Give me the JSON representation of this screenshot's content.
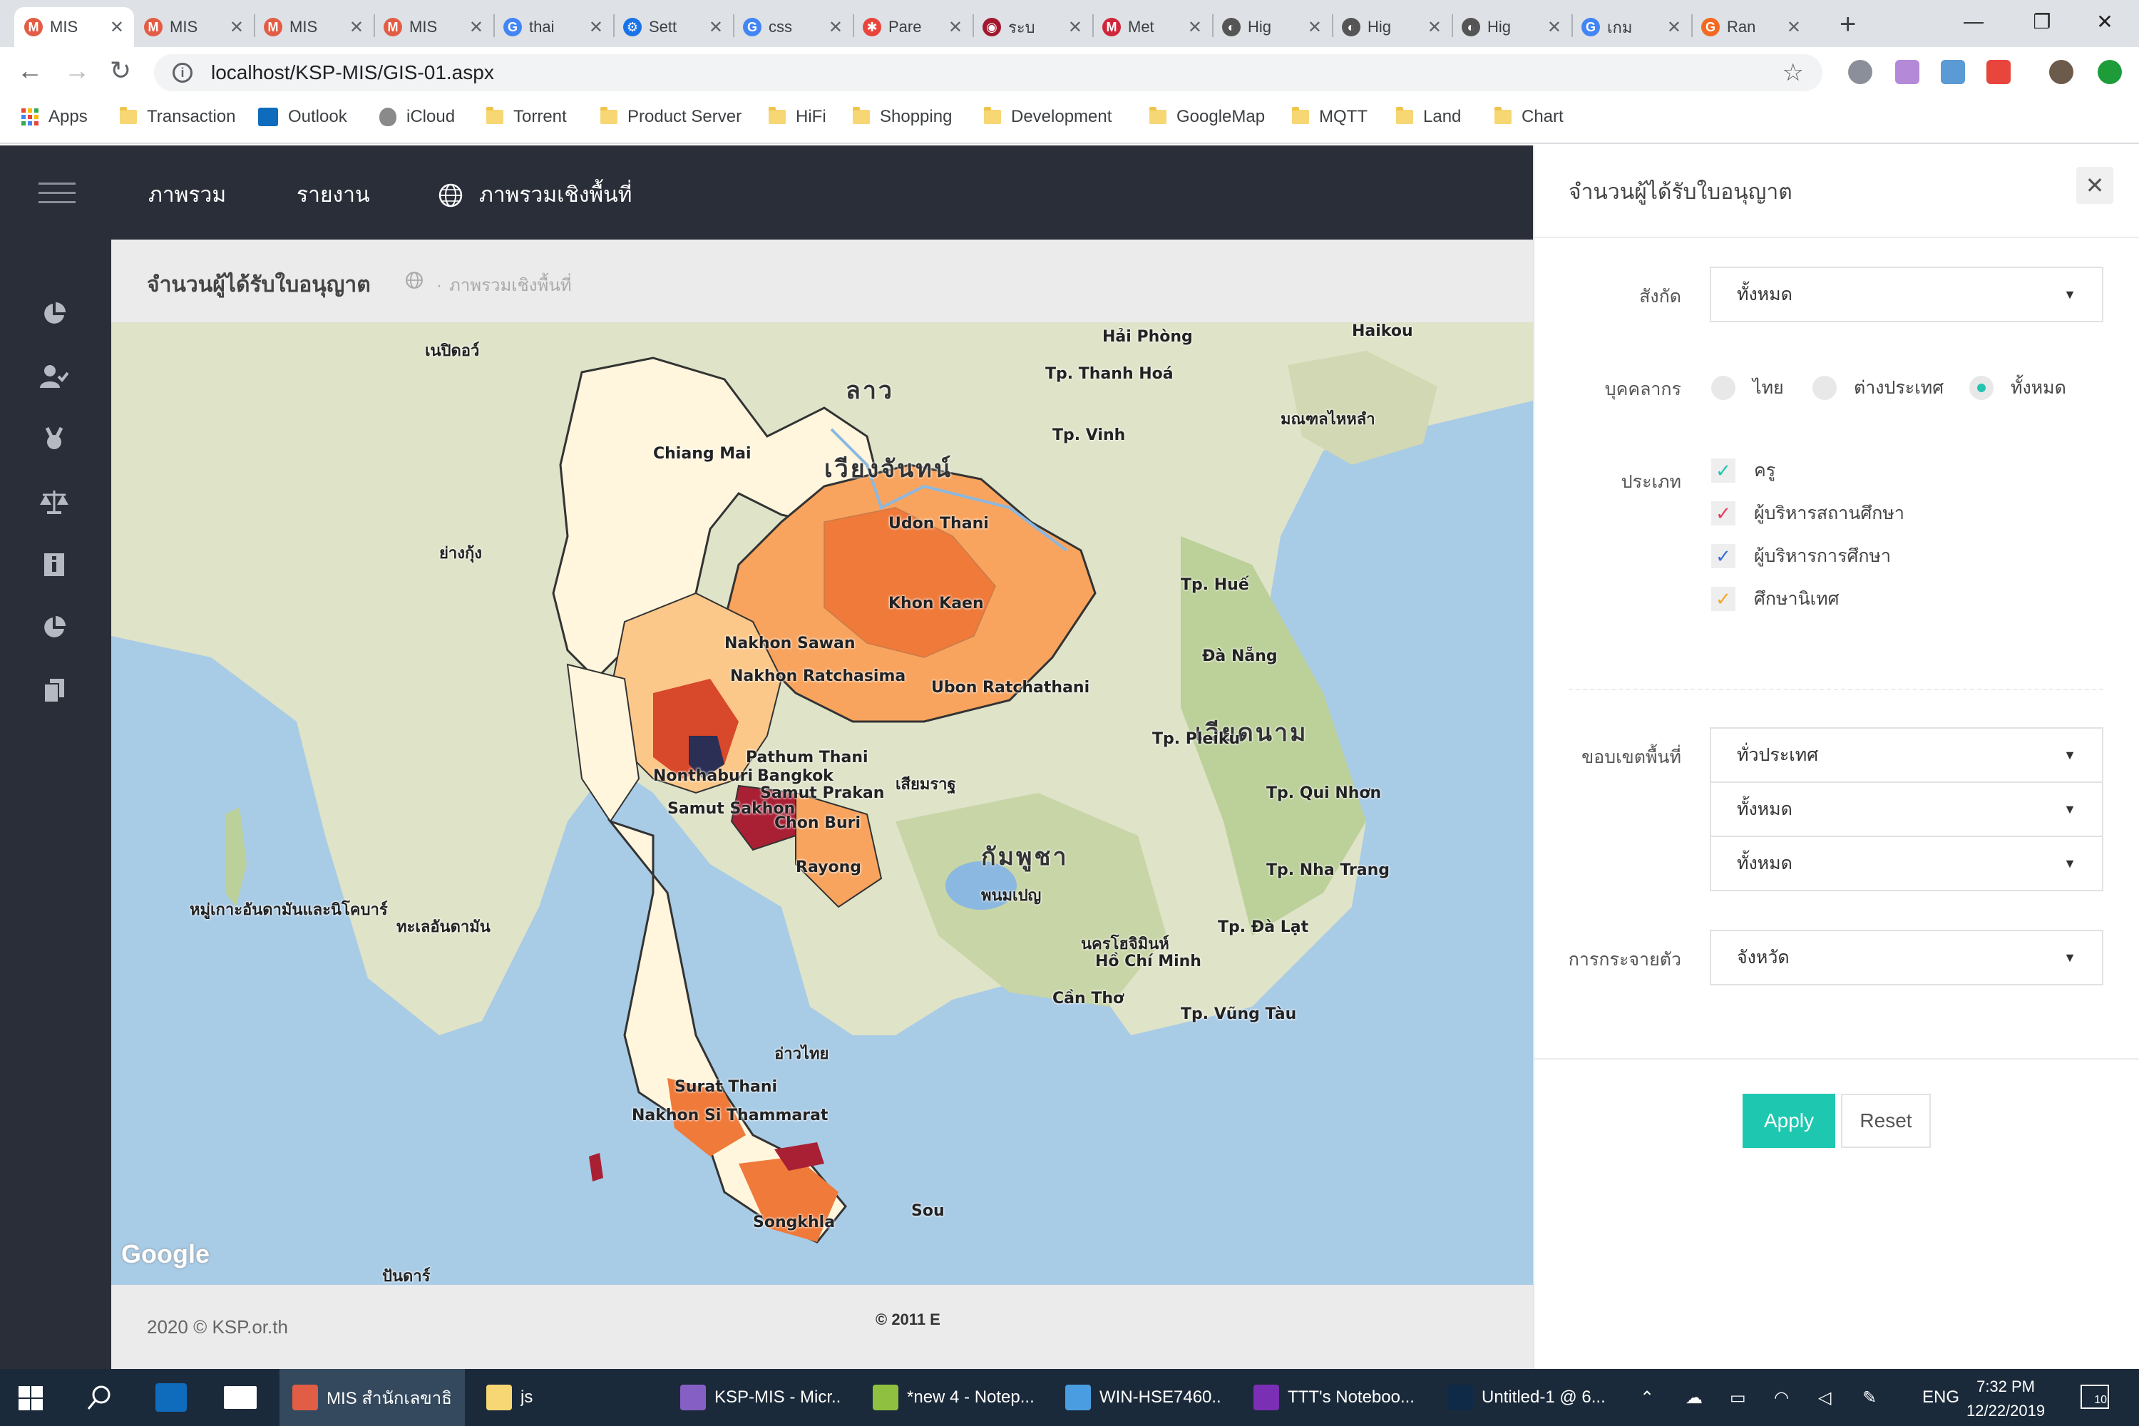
{
  "browser": {
    "tabs": [
      {
        "title": "MIS",
        "fav": "M",
        "color": "#e25d45",
        "active": true
      },
      {
        "title": "MIS",
        "fav": "M",
        "color": "#e25d45"
      },
      {
        "title": "MIS",
        "fav": "M",
        "color": "#e25d45"
      },
      {
        "title": "MIS",
        "fav": "M",
        "color": "#e25d45"
      },
      {
        "title": "thai",
        "fav": "G",
        "color": "#4285f4"
      },
      {
        "title": "Sett",
        "fav": "⚙",
        "color": "#1a73e8"
      },
      {
        "title": "css",
        "fav": "G",
        "color": "#4285f4"
      },
      {
        "title": "Pare",
        "fav": "✱",
        "color": "#e8453c"
      },
      {
        "title": "ระบ",
        "fav": "◉",
        "color": "#a3182e"
      },
      {
        "title": "Met",
        "fav": "M",
        "color": "#d0263b"
      },
      {
        "title": "Hig",
        "fav": "◐",
        "color": "#555555"
      },
      {
        "title": "Hig",
        "fav": "◐",
        "color": "#555555"
      },
      {
        "title": "Hig",
        "fav": "◐",
        "color": "#555555"
      },
      {
        "title": "เกม",
        "fav": "G",
        "color": "#4285f4"
      },
      {
        "title": "Ran",
        "fav": "G",
        "color": "#f26a21"
      }
    ],
    "new_tab": "+",
    "window_controls": {
      "minimize": "—",
      "restore": "❐",
      "close": "✕"
    },
    "url": "localhost/KSP-MIS/GIS-01.aspx",
    "info_icon": "i",
    "star_icon": "☆",
    "nav": {
      "back": "←",
      "forward": "→",
      "reload": "↻"
    },
    "bookmarks": [
      {
        "label": "Apps",
        "kind": "apps"
      },
      {
        "label": "Transaction",
        "kind": "folder"
      },
      {
        "label": "Outlook",
        "kind": "outlook"
      },
      {
        "label": "iCloud",
        "kind": "apple"
      },
      {
        "label": "Torrent",
        "kind": "folder"
      },
      {
        "label": "Product Server",
        "kind": "folder"
      },
      {
        "label": "HiFi",
        "kind": "folder"
      },
      {
        "label": "Shopping",
        "kind": "folder"
      },
      {
        "label": "Development",
        "kind": "folder"
      },
      {
        "label": "GoogleMap",
        "kind": "folder"
      },
      {
        "label": "MQTT",
        "kind": "folder"
      },
      {
        "label": "Land",
        "kind": "folder"
      },
      {
        "label": "Chart",
        "kind": "folder"
      }
    ]
  },
  "app": {
    "nav": [
      "ภาพรวม",
      "รายงาน",
      "ภาพรวมเชิงพื้นที่"
    ],
    "page_title": "จำนวนผู้ได้รับใบอนุญาต",
    "breadcrumb": "ภาพรวมเชิงพื้นที่",
    "footer": "2020 © KSP.or.th",
    "map_copyright": "© 2011 E",
    "google": "Google"
  },
  "map_labels": [
    {
      "text": "ลาว",
      "big": true
    },
    {
      "text": "เวียงจันทน์",
      "big": true
    },
    {
      "text": "กัมพูชา",
      "big": true
    },
    {
      "text": "เวียดนาม",
      "big": true
    },
    {
      "text": "Chiang Mai"
    },
    {
      "text": "Udon Thani"
    },
    {
      "text": "Khon Kaen"
    },
    {
      "text": "Nakhon Sawan"
    },
    {
      "text": "Nakhon Ratchasima"
    },
    {
      "text": "Ubon Ratchathani"
    },
    {
      "text": "Pathum Thani"
    },
    {
      "text": "Nonthaburi"
    },
    {
      "text": "Bangkok"
    },
    {
      "text": "Samut Prakan"
    },
    {
      "text": "Samut Sakhon"
    },
    {
      "text": "Chon Buri"
    },
    {
      "text": "Rayong"
    },
    {
      "text": "Surat Thani"
    },
    {
      "text": "Nakhon Si Thammarat"
    },
    {
      "text": "Songkhla"
    },
    {
      "text": "Hải Phòng"
    },
    {
      "text": "Tp. Thanh Hoá"
    },
    {
      "text": "Tp. Vinh"
    },
    {
      "text": "Tp. Huế"
    },
    {
      "text": "Đà Nẵng"
    },
    {
      "text": "Tp. Pleiku"
    },
    {
      "text": "Tp. Qui Nhơn"
    },
    {
      "text": "Tp. Nha Trang"
    },
    {
      "text": "Tp. Đà Lạt"
    },
    {
      "text": "Hồ Chí Minh"
    },
    {
      "text": "Cần Thơ"
    },
    {
      "text": "Tp. Vũng Tàu"
    },
    {
      "text": "นครโฮจิมินห์"
    },
    {
      "text": "พนมเปญ"
    },
    {
      "text": "เสียมราฐ"
    },
    {
      "text": "มณฑลไหหลำ"
    },
    {
      "text": "หมู่เกาะอันดามันและนิโคบาร์"
    },
    {
      "text": "ทะเลอันดามัน"
    },
    {
      "text": "อ่าวไทย"
    },
    {
      "text": "เนปิดอว์"
    },
    {
      "text": "ย่างกุ้ง"
    },
    {
      "text": "Haikou"
    },
    {
      "text": "Sou"
    },
    {
      "text": "ปันดาร์"
    }
  ],
  "panel": {
    "title": "จำนวนผู้ได้รับใบอนุญาต",
    "close": "✕",
    "affiliation_label": "สังกัด",
    "affiliation_value": "ทั้งหมด",
    "personnel_label": "บุคคลากร",
    "personnel_options": [
      {
        "label": "ไทย",
        "selected": false
      },
      {
        "label": "ต่างประเทศ",
        "selected": false
      },
      {
        "label": "ทั้งหมด",
        "selected": true
      }
    ],
    "type_label": "ประเภท",
    "types": [
      {
        "label": "ครู",
        "checked": true,
        "color": "#1ec7b0"
      },
      {
        "label": "ผู้บริหารสถานศึกษา",
        "checked": true,
        "color": "#e6395f"
      },
      {
        "label": "ผู้บริหารการศึกษา",
        "checked": true,
        "color": "#3a6fd8"
      },
      {
        "label": "ศึกษานิเทศ",
        "checked": true,
        "color": "#f5a623"
      }
    ],
    "area_label": "ขอบเขตพื้นที่",
    "area_values": [
      "ทั่วประเทศ",
      "ทั้งหมด",
      "ทั้งหมด"
    ],
    "distribution_label": "การกระจายตัว",
    "distribution_value": "จังหวัด",
    "apply": "Apply",
    "reset": "Reset"
  },
  "taskbar": {
    "apps": [
      {
        "label": "MIS สำนักเลขาธิ...",
        "color": "#e25d45",
        "active": true
      },
      {
        "label": "js",
        "color": "#f7d774"
      },
      {
        "label": "KSP-MIS - Micr...",
        "color": "#865fc5"
      },
      {
        "label": "*new 4 - Notep...",
        "color": "#90c040"
      },
      {
        "label": "WIN-HSE7460...",
        "color": "#4a9de0"
      },
      {
        "label": "TTT's Noteboo...",
        "color": "#7b2fb5"
      },
      {
        "label": "Untitled-1 @ 6...",
        "color": "#0e2a47"
      }
    ],
    "lang": "ENG",
    "time": "7:32 PM",
    "date": "12/22/2019",
    "notifications": "10"
  },
  "colors": {
    "dark": "#2a2e38",
    "accent": "#1ec7b0",
    "choropleth": [
      "#fff6dd",
      "#fde3b5",
      "#fcc88a",
      "#f9a45e",
      "#ef7a3a",
      "#d8482a",
      "#a91f34",
      "#2b2e55"
    ]
  }
}
